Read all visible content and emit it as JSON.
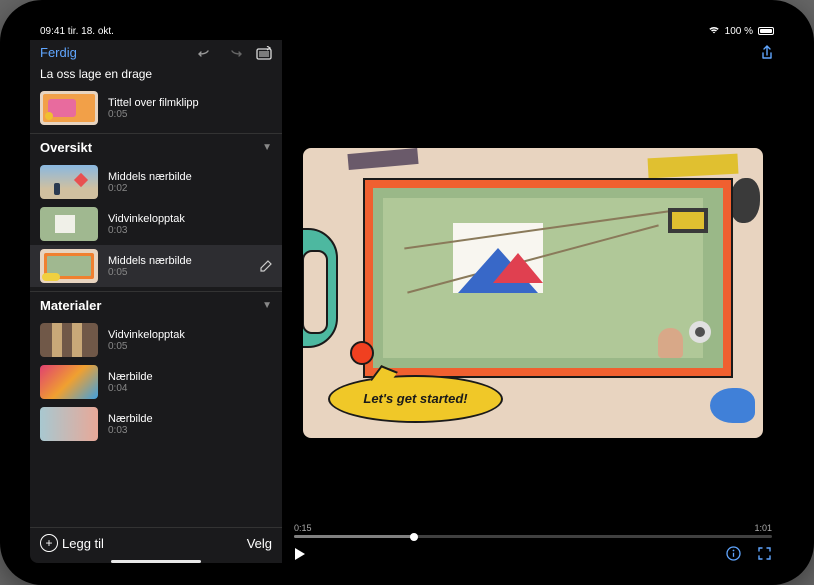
{
  "status": {
    "time_date": "09:41 tir. 18. okt.",
    "battery": "100 %"
  },
  "sidebar": {
    "done": "Ferdig",
    "project_title": "La oss lage en drage",
    "title_clip": {
      "label": "Tittel over filmklipp",
      "time": "0:05"
    },
    "sections": [
      {
        "title": "Oversikt",
        "clips": [
          {
            "label": "Middels nærbilde",
            "time": "0:02"
          },
          {
            "label": "Vidvinkelopptak",
            "time": "0:03"
          },
          {
            "label": "Middels nærbilde",
            "time": "0:05",
            "selected": true
          }
        ]
      },
      {
        "title": "Materialer",
        "clips": [
          {
            "label": "Vidvinkelopptak",
            "time": "0:05"
          },
          {
            "label": "Nærbilde",
            "time": "0:04"
          },
          {
            "label": "Nærbilde",
            "time": "0:03"
          }
        ]
      }
    ],
    "add": "Legg til",
    "select": "Velg"
  },
  "preview": {
    "speech_text": "Let's get started!",
    "current_time": "0:15",
    "total_time": "1:01"
  }
}
